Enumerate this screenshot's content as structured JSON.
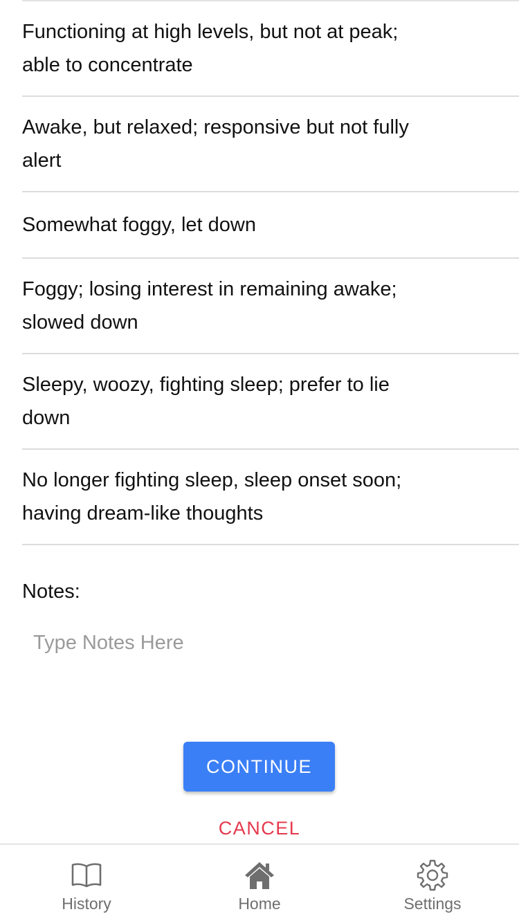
{
  "options": [
    {
      "label": "Functioning at high levels, but not at peak; able to concentrate"
    },
    {
      "label": "Awake, but relaxed; responsive but not fully alert"
    },
    {
      "label": "Somewhat foggy, let down"
    },
    {
      "label": "Foggy; losing interest in remaining awake; slowed down"
    },
    {
      "label": "Sleepy, woozy, fighting sleep; prefer to lie down"
    },
    {
      "label": "No longer fighting sleep, sleep onset soon; having dream-like thoughts"
    }
  ],
  "notes": {
    "label": "Notes:",
    "placeholder": "Type Notes Here",
    "value": ""
  },
  "actions": {
    "continue_label": "CONTINUE",
    "cancel_label": "CANCEL"
  },
  "tabs": [
    {
      "label": "History",
      "icon": "book-icon"
    },
    {
      "label": "Home",
      "icon": "home-icon"
    },
    {
      "label": "Settings",
      "icon": "gear-icon"
    }
  ],
  "colors": {
    "primary": "#3b7ff6",
    "cancel": "#e5394d",
    "tab_icon": "#6e6e6e"
  }
}
